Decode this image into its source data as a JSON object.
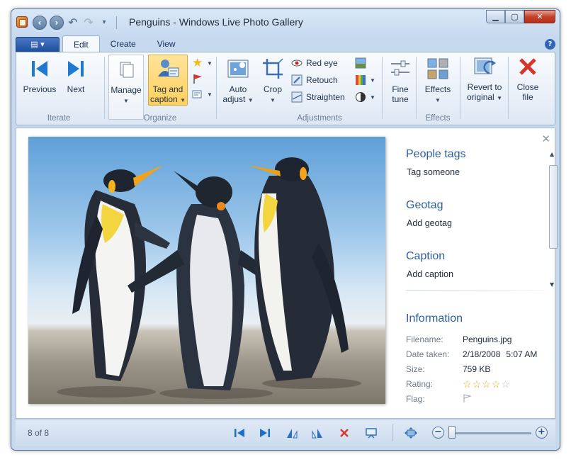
{
  "window": {
    "title": "Penguins - Windows Live Photo Gallery"
  },
  "ribbon": {
    "tabs": [
      {
        "label": "Edit",
        "active": true
      },
      {
        "label": "Create",
        "active": false
      },
      {
        "label": "View",
        "active": false
      }
    ],
    "groups": {
      "iterate": {
        "label": "Iterate",
        "previous": "Previous",
        "next": "Next"
      },
      "organize": {
        "label": "Organize",
        "manage": "Manage",
        "tag_caption_1": "Tag and",
        "tag_caption_2": "caption"
      },
      "adjustments": {
        "label": "Adjustments",
        "auto_adjust_1": "Auto",
        "auto_adjust_2": "adjust",
        "crop": "Crop",
        "red_eye": "Red eye",
        "retouch": "Retouch",
        "straighten": "Straighten",
        "fine_tune_1": "Fine",
        "fine_tune_2": "tune"
      },
      "effects": {
        "label": "Effects",
        "effects": "Effects"
      },
      "revert": {
        "line1": "Revert to",
        "line2": "original"
      },
      "close": {
        "line1": "Close",
        "line2": "file"
      }
    }
  },
  "details": {
    "people_tags": {
      "title": "People tags",
      "link": "Tag someone"
    },
    "geotag": {
      "title": "Geotag",
      "link": "Add geotag"
    },
    "caption": {
      "title": "Caption",
      "link": "Add caption"
    },
    "information": {
      "title": "Information",
      "filename_label": "Filename:",
      "filename": "Penguins.jpg",
      "date_label": "Date taken:",
      "date": "2/18/2008",
      "time": "5:07 AM",
      "size_label": "Size:",
      "size": "759 KB",
      "rating_label": "Rating:",
      "rating": 0,
      "rating_max": 5,
      "flag_label": "Flag:"
    }
  },
  "status": {
    "count": "8 of 8",
    "zoom_level": 0
  },
  "colors": {
    "accent": "#2d5f9e",
    "selected": "#ffcf5c",
    "close_red": "#d9342b"
  }
}
